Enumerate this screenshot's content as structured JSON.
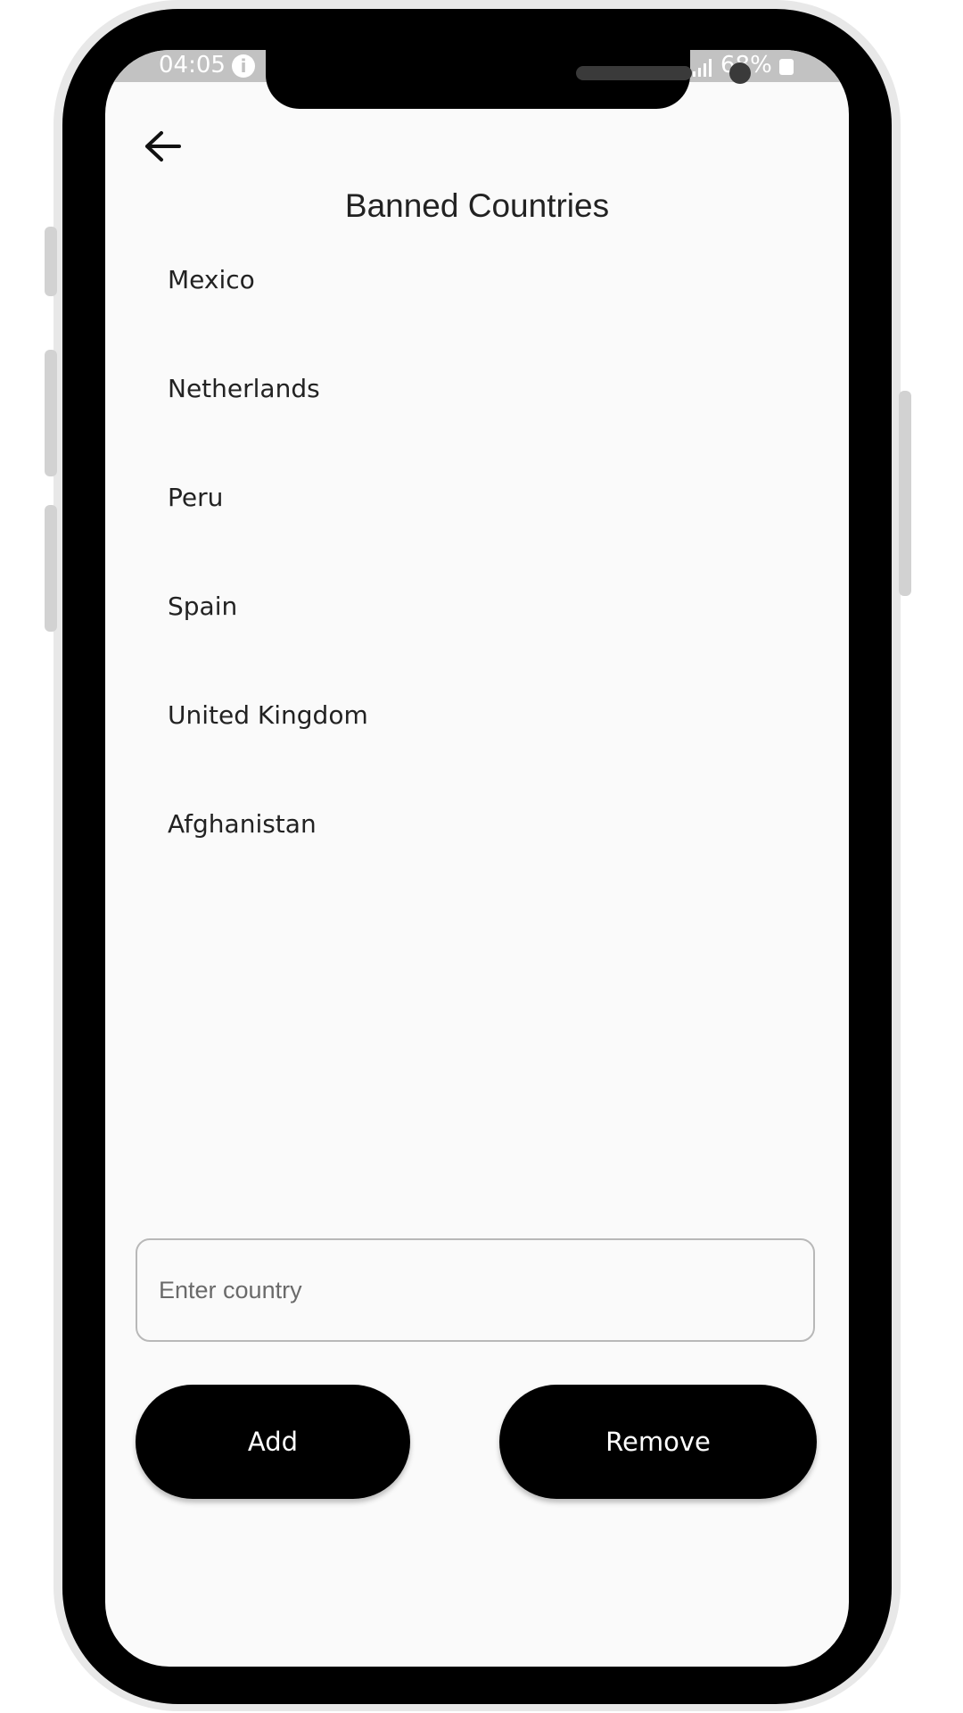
{
  "status_bar": {
    "time": "04:05",
    "info_icon": "i",
    "signal_icon": "signal-icon",
    "battery_text": "68%",
    "battery_icon": "battery-charging-icon"
  },
  "header": {
    "back_icon": "arrow-left-icon",
    "title": "Banned Countries"
  },
  "countries": [
    "Mexico",
    "Netherlands",
    "Peru",
    "Spain",
    "United Kingdom",
    "Afghanistan"
  ],
  "form": {
    "input_placeholder": "Enter country",
    "input_value": "",
    "add_label": "Add",
    "remove_label": "Remove"
  },
  "colors": {
    "screen_background": "#fafafa",
    "button_background": "#000000",
    "button_text": "#ffffff",
    "status_bar": "#c2c2c2"
  }
}
